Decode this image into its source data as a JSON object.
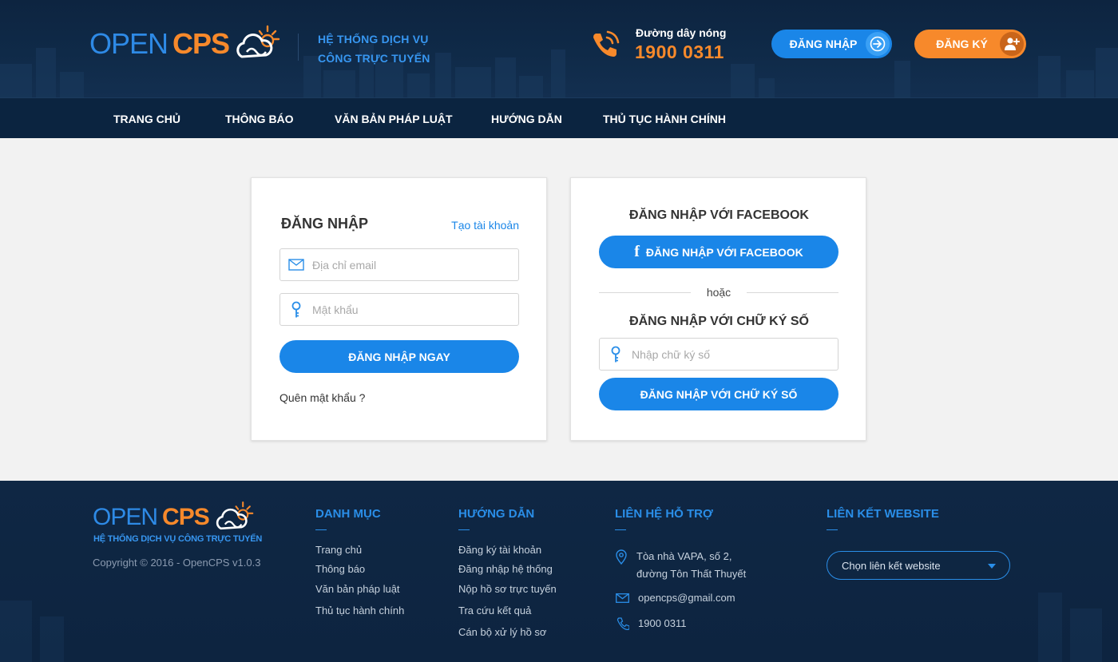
{
  "header": {
    "logo_open": "OPEN",
    "logo_cps": "CPS",
    "tagline_line1": "HỆ THỐNG DỊCH VỤ",
    "tagline_line2": "CÔNG TRỰC TUYẾN",
    "hotline_label": "Đường dây nóng",
    "hotline_number": "1900 0311",
    "login_button": "ĐĂNG NHẬP",
    "register_button": "ĐĂNG KÝ"
  },
  "nav": {
    "items": [
      "TRANG CHỦ",
      "THÔNG BÁO",
      "VĂN BẢN PHÁP LUẬT",
      "HƯỚNG DẪN",
      "THỦ TỤC HÀNH CHÍNH"
    ]
  },
  "login_card": {
    "title": "ĐĂNG NHẬP",
    "create_account": "Tạo tài khoản",
    "email_placeholder": "Địa chỉ email",
    "password_placeholder": "Mật khẩu",
    "submit": "ĐĂNG NHẬP NGAY",
    "forgot": "Quên mật khẩu ?"
  },
  "alt_card": {
    "facebook_title": "ĐĂNG NHẬP VỚI FACEBOOK",
    "facebook_icon_letter": "f",
    "facebook_button": "ĐĂNG NHẬP VỚI FACEBOOK",
    "or": "hoặc",
    "signature_title": "ĐĂNG NHẬP VỚI CHỮ KÝ SỐ",
    "signature_placeholder": "Nhập chữ ký số",
    "signature_button": "ĐĂNG NHẬP VỚI CHỮ KÝ SỐ"
  },
  "footer": {
    "logo_open": "OPEN",
    "logo_cps": "CPS",
    "tagline": "HỆ THỐNG DỊCH VỤ CÔNG TRỰC TUYẾN",
    "copyright": "Copyright © 2016 - OpenCPS v1.0.3",
    "danh_muc": {
      "title": "DANH MỤC",
      "links": [
        "Trang chủ",
        "Thông báo",
        "Văn bản pháp luật",
        "Thủ tục hành chính"
      ]
    },
    "huong_dan": {
      "title": "HƯỚNG DẪN",
      "links": [
        "Đăng ký tài khoản",
        "Đăng nhập hệ thống",
        "Nộp hồ sơ trực tuyến",
        "Tra cứu kết quả",
        "Cán bộ xử lý hồ sơ"
      ]
    },
    "lien_he": {
      "title": "LIÊN HỆ HỖ TRỢ",
      "address_line1": "Tòa nhà VAPA, số 2,",
      "address_line2": "đường Tôn Thất Thuyết",
      "email": "opencps@gmail.com",
      "phone": "1900 0311"
    },
    "lien_ket": {
      "title": "LIÊN KẾT WEBSITE",
      "select_value": "Chọn liên kết website"
    }
  },
  "colors": {
    "brand_blue": "#1a86e8",
    "brand_orange": "#f7892b",
    "header_bg": "#0d2440"
  },
  "icons": {
    "hotline": "phone-ring-icon",
    "login": "arrow-circle-right-icon",
    "register": "add-user-icon",
    "email": "envelope-icon",
    "password": "key-icon",
    "signature": "key-icon",
    "facebook": "facebook-icon",
    "address": "map-pin-icon",
    "mail": "envelope-icon",
    "phone": "phone-icon",
    "select": "caret-down-icon"
  }
}
